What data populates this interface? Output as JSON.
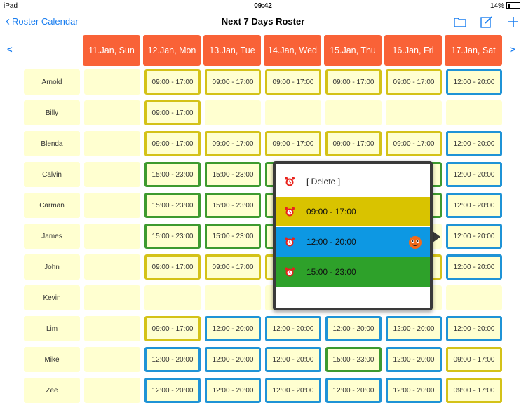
{
  "status": {
    "device": "iPad",
    "time": "09:42",
    "battery": "14%"
  },
  "nav": {
    "back_label": "Roster Calendar",
    "title": "Next 7 Days Roster"
  },
  "prev_arrow": "<",
  "next_arrow": ">",
  "days": [
    "11.Jan, Sun",
    "12.Jan, Mon",
    "13.Jan, Tue",
    "14.Jan, Wed",
    "15.Jan, Thu",
    "16.Jan, Fri",
    "17.Jan, Sat"
  ],
  "colors": {
    "header": "#f96237",
    "cell_bg": "#ffffd0",
    "yellow": "#d4c218",
    "green": "#3d9a2f",
    "blue": "#1f93d6",
    "accent": "#1a7ef0"
  },
  "rows": [
    {
      "name": "Arnold",
      "cells": [
        null,
        {
          "t": "09:00 - 17:00",
          "c": "yellow"
        },
        {
          "t": "09:00 - 17:00",
          "c": "yellow"
        },
        {
          "t": "09:00 - 17:00",
          "c": "yellow"
        },
        {
          "t": "09:00 - 17:00",
          "c": "yellow"
        },
        {
          "t": "09:00 - 17:00",
          "c": "yellow"
        },
        {
          "t": "12:00 - 20:00",
          "c": "blue"
        }
      ]
    },
    {
      "name": "Billy",
      "cells": [
        null,
        {
          "t": "09:00 - 17:00",
          "c": "yellow"
        },
        null,
        null,
        null,
        null,
        null
      ]
    },
    {
      "name": "Blenda",
      "cells": [
        null,
        {
          "t": "09:00 - 17:00",
          "c": "yellow"
        },
        {
          "t": "09:00 - 17:00",
          "c": "yellow"
        },
        {
          "t": "09:00 - 17:00",
          "c": "yellow"
        },
        {
          "t": "09:00 - 17:00",
          "c": "yellow"
        },
        {
          "t": "09:00 - 17:00",
          "c": "yellow"
        },
        {
          "t": "12:00 - 20:00",
          "c": "blue"
        }
      ]
    },
    {
      "name": "Calvin",
      "cells": [
        null,
        {
          "t": "15:00 - 23:00",
          "c": "green"
        },
        {
          "t": "15:00 - 23:00",
          "c": "green"
        },
        {
          "t": "",
          "c": "green"
        },
        null,
        {
          "t": "",
          "c": "green"
        },
        {
          "t": "12:00 - 20:00",
          "c": "blue"
        }
      ]
    },
    {
      "name": "Carman",
      "cells": [
        null,
        {
          "t": "15:00 - 23:00",
          "c": "green"
        },
        {
          "t": "15:00 - 23:00",
          "c": "green"
        },
        {
          "t": "",
          "c": "green"
        },
        null,
        {
          "t": "",
          "c": "green"
        },
        {
          "t": "12:00 - 20:00",
          "c": "blue"
        }
      ]
    },
    {
      "name": "James",
      "cells": [
        null,
        {
          "t": "15:00 - 23:00",
          "c": "green"
        },
        {
          "t": "15:00 - 23:00",
          "c": "green"
        },
        {
          "t": "",
          "c": "green"
        },
        null,
        null,
        {
          "t": "12:00 - 20:00",
          "c": "blue"
        }
      ]
    },
    {
      "name": "John",
      "cells": [
        null,
        {
          "t": "09:00 - 17:00",
          "c": "yellow"
        },
        {
          "t": "09:00 - 17:00",
          "c": "yellow"
        },
        {
          "t": "",
          "c": "yellow"
        },
        null,
        {
          "t": "",
          "c": "yellow"
        },
        {
          "t": "12:00 - 20:00",
          "c": "blue"
        }
      ]
    },
    {
      "name": "Kevin",
      "cells": [
        null,
        null,
        null,
        null,
        null,
        null,
        null
      ]
    },
    {
      "name": "Lim",
      "cells": [
        null,
        {
          "t": "09:00 - 17:00",
          "c": "yellow"
        },
        {
          "t": "12:00 - 20:00",
          "c": "blue"
        },
        {
          "t": "12:00 - 20:00",
          "c": "blue"
        },
        {
          "t": "12:00 - 20:00",
          "c": "blue"
        },
        {
          "t": "12:00 - 20:00",
          "c": "blue"
        },
        {
          "t": "12:00 - 20:00",
          "c": "blue"
        }
      ]
    },
    {
      "name": "Mike",
      "cells": [
        null,
        {
          "t": "12:00 - 20:00",
          "c": "blue"
        },
        {
          "t": "12:00 - 20:00",
          "c": "blue"
        },
        {
          "t": "12:00 - 20:00",
          "c": "blue"
        },
        {
          "t": "15:00 - 23:00",
          "c": "green"
        },
        {
          "t": "12:00 - 20:00",
          "c": "blue"
        },
        {
          "t": "09:00 - 17:00",
          "c": "yellow"
        }
      ]
    },
    {
      "name": "Zee",
      "cells": [
        null,
        {
          "t": "12:00 - 20:00",
          "c": "blue"
        },
        {
          "t": "12:00 - 20:00",
          "c": "blue"
        },
        {
          "t": "12:00 - 20:00",
          "c": "blue"
        },
        {
          "t": "12:00 - 20:00",
          "c": "blue"
        },
        {
          "t": "12:00 - 20:00",
          "c": "blue"
        },
        {
          "t": "09:00 - 17:00",
          "c": "yellow"
        }
      ]
    }
  ],
  "popup": {
    "options": [
      {
        "label": "[ Delete ]",
        "bg": "#ffffff"
      },
      {
        "label": "09:00 - 17:00",
        "bg": "#d9c300"
      },
      {
        "label": "12:00 - 20:00",
        "bg": "#0d98e3"
      },
      {
        "label": "15:00 - 23:00",
        "bg": "#2ea12a"
      }
    ],
    "icons": {
      "option": "alarm-clock-icon",
      "selected": "mascot-icon"
    }
  }
}
